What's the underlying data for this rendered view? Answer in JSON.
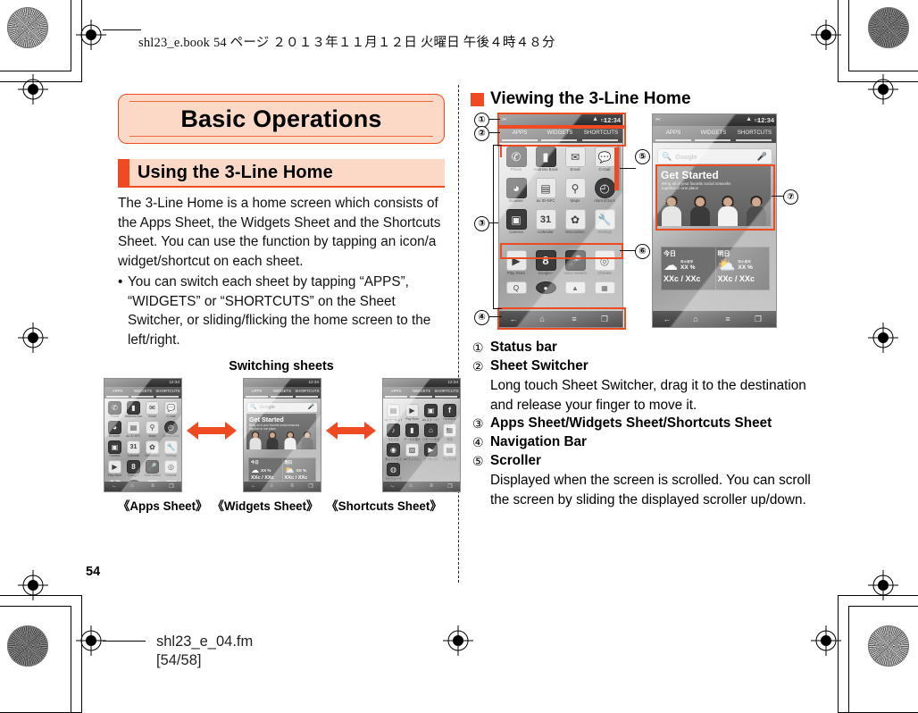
{
  "header": {
    "slug": "shl23_e.book    54 ページ    ２０１３年１１月１２日    火曜日    午後４時４８分"
  },
  "footer": {
    "page_number": "54",
    "file_name": "shl23_e_04.fm",
    "page_range": "[54/58]"
  },
  "colors": {
    "accent": "#f04a22",
    "banner_fill": "#fbd9c6",
    "banner_border": "#ef4a22"
  },
  "left_column": {
    "chapter_banner": "Basic Operations",
    "section_heading": "Using the 3-Line Home",
    "paragraph": "The 3-Line Home is a home screen which consists of the Apps Sheet, the Widgets Sheet and the Shortcuts Sheet. You can use the function by tapping an icon/a widget/shortcut on each sheet.",
    "bullets": [
      {
        "marker": "•",
        "text": "You can switch each sheet by tapping “APPS”, “WIDGETS” or “SHORTCUTS” on the Sheet Switcher, or sliding/flicking the home screen to the left/right."
      }
    ],
    "figure": {
      "title": "Switching sheets",
      "captions": [
        "《Apps Sheet》",
        "《Widgets Sheet》",
        "《Shortcuts Sheet》"
      ]
    }
  },
  "right_column": {
    "heading": "Viewing the 3-Line Home",
    "items": [
      {
        "num": "①",
        "label": "Status bar",
        "desc": ""
      },
      {
        "num": "②",
        "label": "Sheet Switcher",
        "desc": "Long touch Sheet Switcher, drag it to the destination and release your finger to move it."
      },
      {
        "num": "③",
        "label": "Apps Sheet/Widgets Sheet/Shortcuts Sheet",
        "desc": ""
      },
      {
        "num": "④",
        "label": "Navigation Bar",
        "desc": ""
      },
      {
        "num": "⑤",
        "label": "Scroller",
        "desc": "Displayed when the screen is scrolled. You can scroll the screen by sliding the displayed scroller up/down."
      }
    ],
    "callout_markers": [
      "①",
      "②",
      "③",
      "④",
      "⑤",
      "⑥",
      "⑦"
    ]
  },
  "phone_ui": {
    "status_time": "12:34",
    "switcher_tabs": [
      "APPS",
      "WIDGETS",
      "SHORTCUTS"
    ],
    "search_placeholder": "Google",
    "widget": {
      "title": "Get Started",
      "subtitle_line1": "Bring all of your favorite social networks",
      "subtitle_line2": "together in one place"
    },
    "weather": {
      "today_label": "今日",
      "tomorrow_label": "明日",
      "rain_label": "降水確率",
      "rain_value": "XX %",
      "temps": "XXc / XXc"
    },
    "apps_sheet_icons": [
      {
        "label": "Phone",
        "glyph": "✆"
      },
      {
        "label": "Address Book",
        "glyph": "👤"
      },
      {
        "label": "Email",
        "glyph": "✉"
      },
      {
        "label": "C-mail",
        "glyph": "💬"
      },
      {
        "label": "Browser",
        "glyph": "◕"
      },
      {
        "label": "au ID-NFC",
        "glyph": "▤"
      },
      {
        "label": "Maps",
        "glyph": "⚲"
      },
      {
        "label": "Alarm/Clock",
        "glyph": "◴"
      },
      {
        "label": "Camera",
        "glyph": "📷"
      },
      {
        "label": "Calendar",
        "glyph": "31"
      },
      {
        "label": "Decoration",
        "glyph": "✿"
      },
      {
        "label": "Settings",
        "glyph": "🔧"
      },
      {
        "label": "Play Store",
        "glyph": "▶"
      },
      {
        "label": "Google+",
        "glyph": "8"
      },
      {
        "label": "Voice Search",
        "glyph": "🎤"
      },
      {
        "label": "Chrome",
        "glyph": "◎"
      }
    ],
    "shortcuts_sheet_icons": [
      {
        "label": "au マーケット",
        "glyph": "▤"
      },
      {
        "label": "Play Store",
        "glyph": "▶"
      },
      {
        "label": "au スマートパス",
        "glyph": "▣"
      },
      {
        "label": "Facebook",
        "glyph": "f"
      },
      {
        "label": "うたパス",
        "glyph": "♪"
      },
      {
        "label": "データお預かり",
        "glyph": "👤"
      },
      {
        "label": "リモートサポート",
        "glyph": "⌂"
      },
      {
        "label": "電卓",
        "glyph": "▦"
      },
      {
        "label": "安心アクセス",
        "glyph": "◉"
      },
      {
        "label": "au ウィジェット",
        "glyph": "▨"
      },
      {
        "label": "ビデオパス",
        "glyph": "▶"
      },
      {
        "label": "ブックパス",
        "glyph": "▤"
      },
      {
        "label": "ナビウォーク",
        "glyph": "◍"
      }
    ],
    "nav_icons": [
      "back-icon",
      "home-icon",
      "menu-icon",
      "recents-icon"
    ]
  }
}
